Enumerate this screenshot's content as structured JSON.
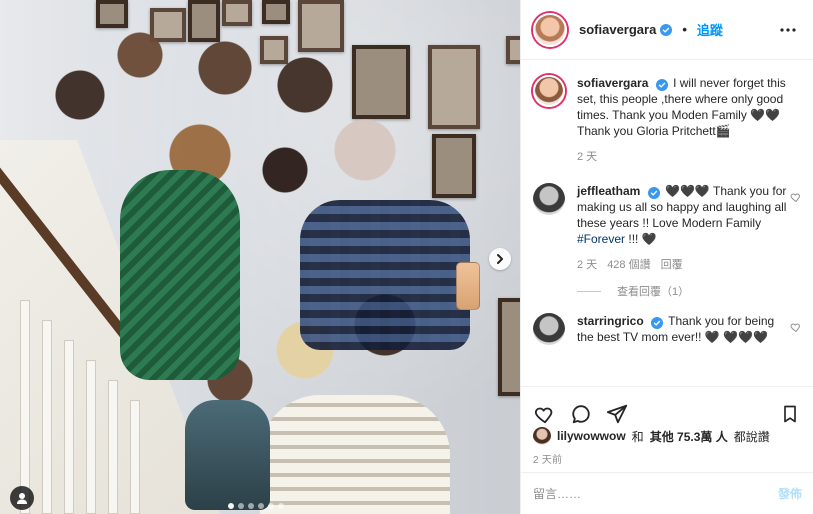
{
  "header": {
    "username": "sofiavergara",
    "follow_label": "追蹤",
    "more_icon": "more-icon"
  },
  "comments": [
    {
      "username": "sofiavergara",
      "text": "I will never forget this set, this people ,there where only good times. Thank you Moden Family 🖤🖤 Thank you Gloria Pritchett🎬",
      "time": "2 天"
    },
    {
      "username": "jeffleatham",
      "text": "🖤🖤🖤 Thank you for making us all so happy and laughing all these years !! Love Modern Family",
      "hashtag": "#Forever",
      "tail": " !!! 🖤",
      "time": "2 天",
      "likes": "428 個讚",
      "reply_label": "回覆"
    },
    {
      "username": "starringrico",
      "text": "Thank you for being the best TV mom ever!! 🖤 🖤🖤🖤"
    }
  ],
  "view_replies_label": "查看回覆（1）",
  "likes": {
    "first_user": "lilywowwow",
    "conj": "和",
    "others_label": "其他 75.3萬 人",
    "suffix": "都說讚"
  },
  "timestamp": "2 天前",
  "add_comment": {
    "placeholder": "留言……",
    "post_label": "發佈"
  },
  "carousel": {
    "dot_count": 6,
    "active_index": 0
  },
  "colors": {
    "accent": "#0095f6",
    "verified": "#3897f0",
    "muted": "#8e8e8e",
    "border": "#efefef"
  }
}
